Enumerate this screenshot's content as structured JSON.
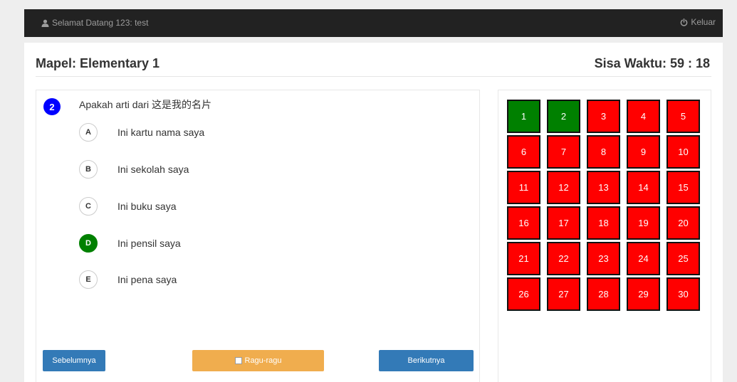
{
  "navbar": {
    "welcome": "Selamat Datang 123: test",
    "logout_label": "Keluar"
  },
  "header": {
    "subject": "Mapel: Elementary 1",
    "timer": "Sisa Waktu: 59 : 18"
  },
  "question": {
    "number": "2",
    "text": "Apakah arti dari 这是我的名片",
    "selected_option": "D",
    "options": [
      {
        "letter": "A",
        "text": "Ini kartu nama saya"
      },
      {
        "letter": "B",
        "text": "Ini sekolah saya"
      },
      {
        "letter": "C",
        "text": "Ini buku saya"
      },
      {
        "letter": "D",
        "text": "Ini pensil saya"
      },
      {
        "letter": "E",
        "text": "Ini pena saya"
      }
    ]
  },
  "buttons": {
    "prev_label": "Sebelumnya",
    "doubt_label": "Ragu-ragu",
    "next_label": "Berikutnya"
  },
  "colors": {
    "answered": "#008000",
    "unanswered": "#ff0000",
    "current_question_badge": "#0000ff",
    "primary_button": "#337ab7",
    "warning_button": "#f0ad4e"
  },
  "navigator": {
    "numbers": [
      "1",
      "2",
      "3",
      "4",
      "5",
      "6",
      "7",
      "8",
      "9",
      "10",
      "11",
      "12",
      "13",
      "14",
      "15",
      "16",
      "17",
      "18",
      "19",
      "20",
      "21",
      "22",
      "23",
      "24",
      "25",
      "26",
      "27",
      "28",
      "29",
      "30"
    ],
    "answered": [
      "1",
      "2"
    ]
  }
}
